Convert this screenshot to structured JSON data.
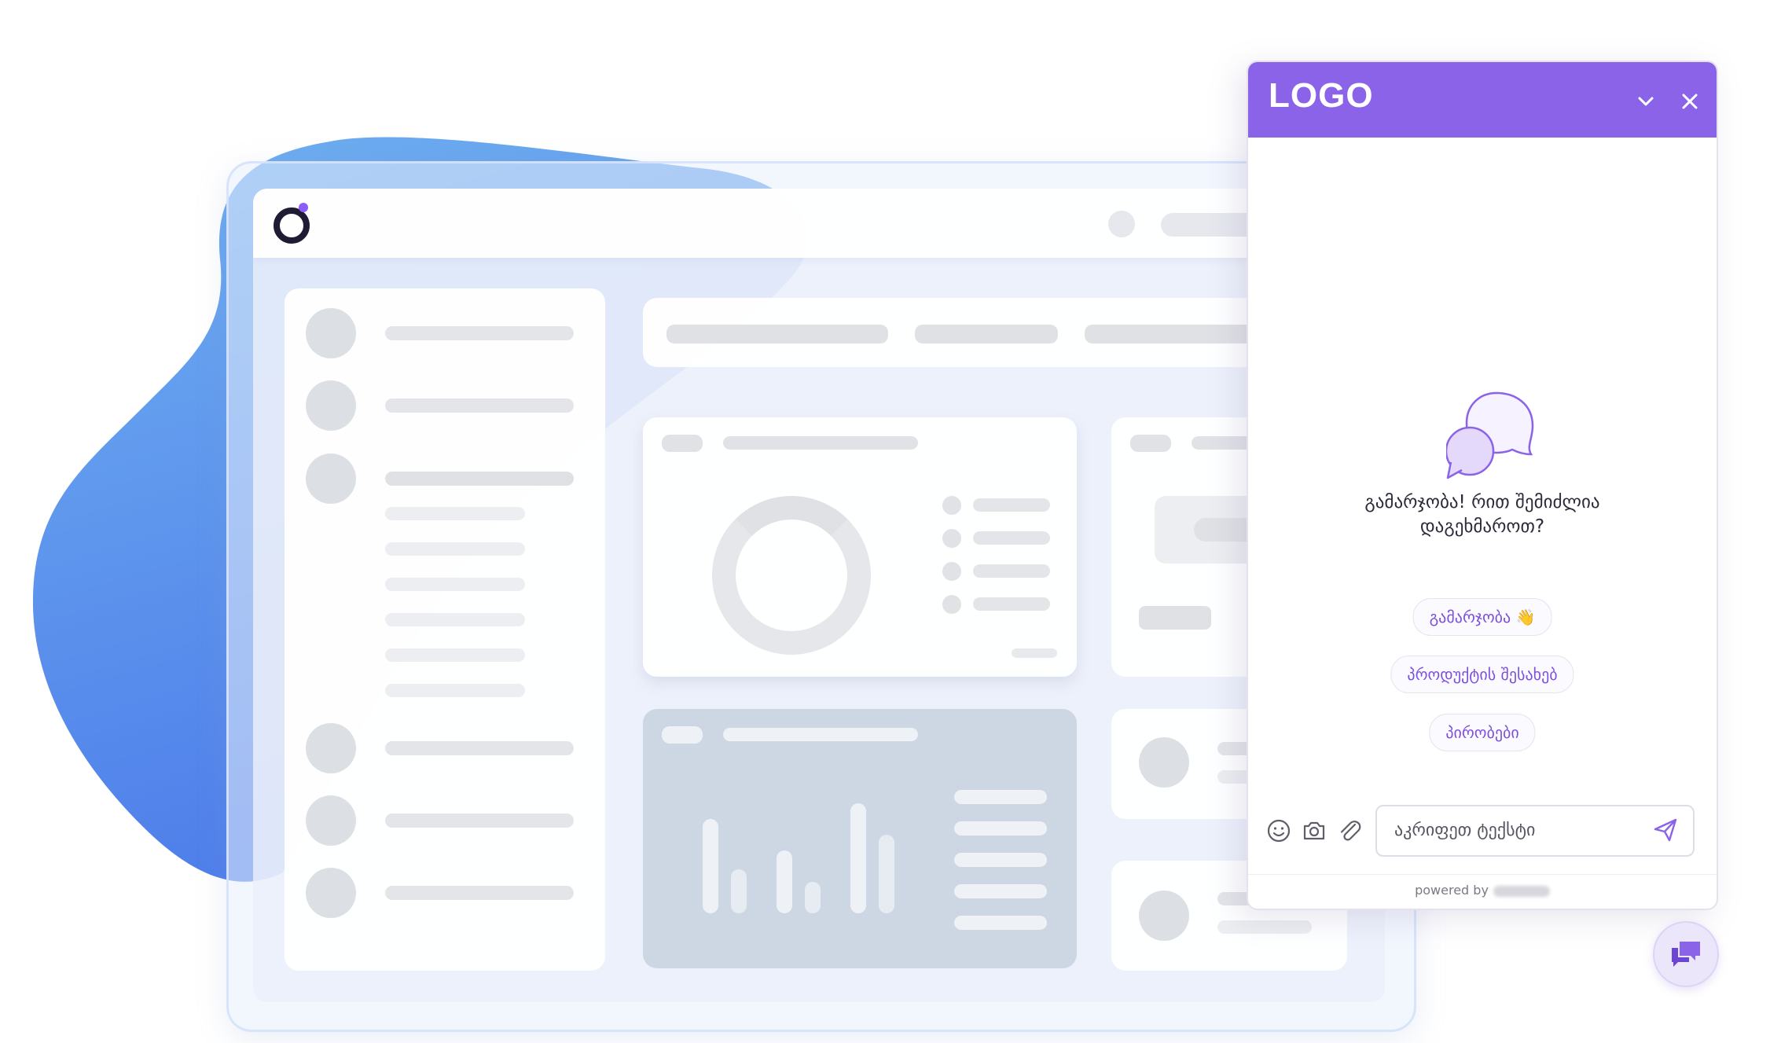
{
  "widget": {
    "logo": "LOGO",
    "brand_color": "#8b63e9",
    "greeting_line1": "გამარჯობა! რით შემიძლია",
    "greeting_line2": "დაგეხმაროთ?",
    "quick_replies": [
      "გამარჯობა 👋",
      "პროდუქტის შესახებ",
      "პირობები"
    ],
    "input_placeholder": "აკრიფეთ ტექსტი",
    "powered_by": "powered by",
    "icons": {
      "minimize": "chevron-down-icon",
      "close": "close-icon",
      "empty_state": "chat-bubbles-icon",
      "emoji": "emoji-icon",
      "camera": "camera-icon",
      "attach": "paperclip-icon",
      "send": "send-icon",
      "launcher": "chat-launcher-icon"
    }
  },
  "background": {
    "blob_gradient": [
      "#6fa6ee",
      "#4f7fea"
    ],
    "dashboard_logo_accent": "#8b5cf6"
  }
}
